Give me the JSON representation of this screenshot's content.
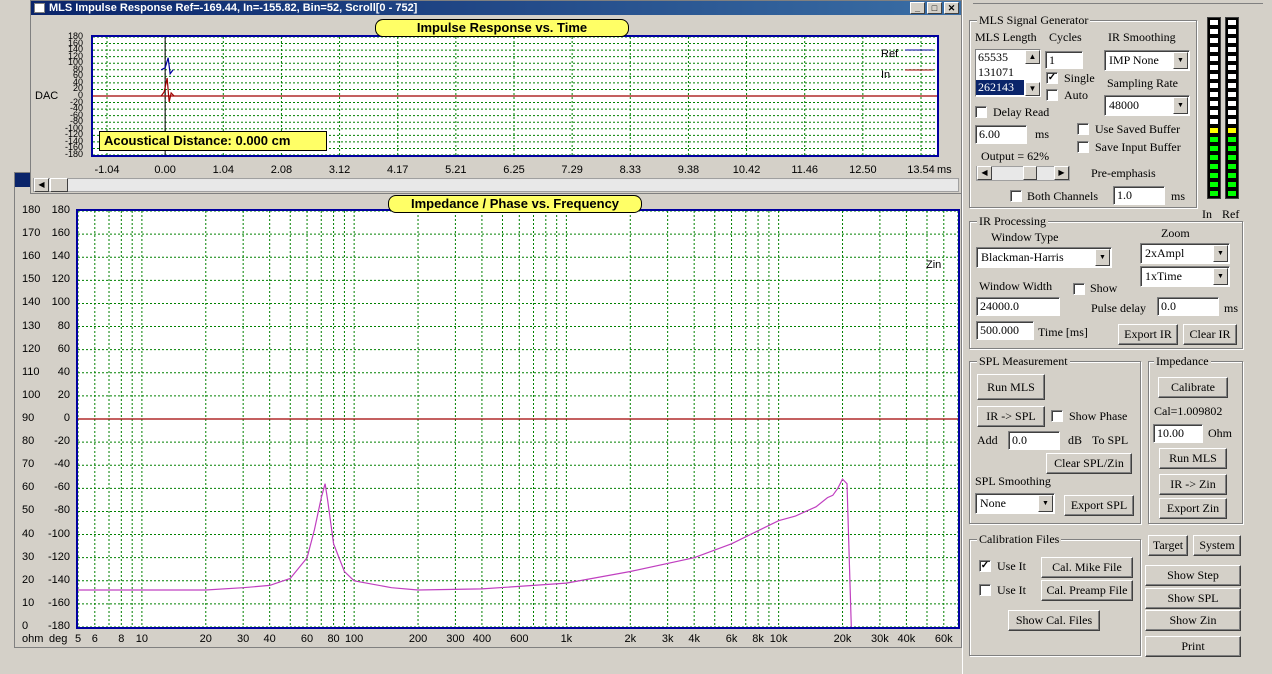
{
  "impulse_window": {
    "title": "MLS Impulse Response  Ref=-169.44, In=-155.82, Bin=52, Scroll[0 - 752]",
    "plot_title": "Impulse Response vs. Time",
    "y_axis_label": "DAC",
    "y_ticks": [
      "180",
      "160",
      "140",
      "120",
      "100",
      "80",
      "60",
      "40",
      "20",
      "0",
      "-20",
      "-40",
      "-60",
      "-80",
      "-100",
      "-120",
      "-140",
      "-160",
      "-180"
    ],
    "x_ticks": [
      "-1.04",
      "0.00",
      "1.04",
      "2.08",
      "3.12",
      "4.17",
      "5.21",
      "6.25",
      "7.29",
      "8.33",
      "9.38",
      "10.42",
      "11.46",
      "12.50",
      "13.54"
    ],
    "x_unit": "ms",
    "legend": [
      "Ref",
      "In"
    ],
    "distance_label": "Acoustical Distance: 0.000 cm",
    "colors": {
      "ref": "#0000a0",
      "in": "#a00000"
    }
  },
  "impedance_plot": {
    "plot_title": "Impedance / Phase vs. Frequency",
    "ohm_ticks": [
      "180",
      "170",
      "160",
      "150",
      "140",
      "130",
      "120",
      "110",
      "100",
      "90",
      "80",
      "70",
      "60",
      "50",
      "40",
      "30",
      "20",
      "10",
      "0"
    ],
    "deg_ticks": [
      "180",
      "160",
      "140",
      "120",
      "100",
      "80",
      "60",
      "40",
      "20",
      "0",
      "-20",
      "-40",
      "-60",
      "-80",
      "-100",
      "-120",
      "-140",
      "-160",
      "-180"
    ],
    "ohm_unit": "ohm",
    "deg_unit": "deg",
    "x_ticks": [
      "5",
      "6",
      "8",
      "10",
      "20",
      "30",
      "40",
      "60",
      "80",
      "100",
      "200",
      "300",
      "400",
      "600",
      "1k",
      "2k",
      "3k",
      "4k",
      "6k",
      "8k",
      "10k",
      "20k",
      "30k",
      "40k",
      "60k"
    ],
    "legend": "Zin",
    "colors": {
      "zin": "#c040c0",
      "phase": "#a00000"
    }
  },
  "chart_data": {
    "type": "line",
    "title": "Impedance / Phase vs. Frequency",
    "xlabel": "",
    "ylabel": "ohm",
    "x_scale": "log",
    "xlim": [
      5,
      70000
    ],
    "ylim": [
      0,
      180
    ],
    "grid": true,
    "series": [
      {
        "name": "Zin",
        "x": [
          5,
          10,
          20,
          30,
          40,
          50,
          60,
          65,
          70,
          73,
          75,
          80,
          90,
          100,
          150,
          200,
          400,
          1000,
          2000,
          4000,
          6000,
          10000,
          12000,
          15000,
          17000,
          18000,
          19000,
          20000,
          21000,
          22000
        ],
        "values": [
          16,
          16,
          16,
          17,
          18,
          21,
          30,
          42,
          56,
          62,
          55,
          36,
          24,
          20,
          17,
          16,
          16.5,
          19,
          24,
          30,
          36,
          46,
          48,
          52,
          56,
          57,
          60,
          64,
          62,
          0
        ]
      },
      {
        "x": [
          5,
          70000
        ],
        "values": [
          90,
          90
        ]
      }
    ]
  },
  "generator": {
    "group_label": "MLS Signal Generator",
    "mls_length_label": "MLS Length",
    "mls_options": [
      "65535",
      "131071",
      "262143"
    ],
    "cycles_label": "Cycles",
    "cycles_value": "1",
    "single_label": "Single",
    "auto_label": "Auto",
    "ir_smoothing_label": "IR Smoothing",
    "ir_smoothing_value": "IMP None",
    "sampling_rate_label": "Sampling Rate",
    "sampling_rate_value": "48000",
    "delay_read_label": "Delay Read",
    "delay_value": "6.00",
    "delay_unit": "ms",
    "use_saved_label": "Use Saved Buffer",
    "save_input_label": "Save Input Buffer",
    "output_label": "Output = 62%",
    "output_level": 0.62,
    "preemph_label": "Pre-emphasis",
    "both_channels_label": "Both Channels",
    "preemph_value": "1.0",
    "preemph_unit": "ms"
  },
  "meters": {
    "in_label": "In",
    "ref_label": "Ref",
    "green": "#00ff00",
    "yellow": "#ffff00",
    "off": "#ffffff"
  },
  "ir_processing": {
    "group_label": "IR Processing",
    "window_type_label": "Window Type",
    "window_type_value": "Blackman-Harris",
    "zoom_label": "Zoom",
    "zoom_ampl_value": "2xAmpl",
    "zoom_time_value": "1xTime",
    "window_width_label": "Window Width",
    "show_label": "Show",
    "window_width_value": "24000.0",
    "pulse_delay_label": "Pulse delay",
    "pulse_delay_value": "0.0",
    "pulse_delay_unit": "ms",
    "time_value": "500.000",
    "time_label": "Time [ms]",
    "export_ir": "Export IR",
    "clear_ir": "Clear IR"
  },
  "spl": {
    "group_label": "SPL Measurement",
    "run_mls": "Run MLS",
    "ir_to_spl": "IR -> SPL",
    "show_phase_label": "Show Phase",
    "add_label": "Add",
    "add_value": "0.0",
    "db_label": "dB",
    "to_spl_label": "To SPL",
    "clear_spl_zin": "Clear SPL/Zin",
    "smoothing_label": "SPL Smoothing",
    "smoothing_value": "None",
    "export_spl": "Export SPL"
  },
  "impedance": {
    "group_label": "Impedance",
    "calibrate": "Calibrate",
    "cal_label": "Cal=1.009802",
    "ohm_value": "10.00",
    "ohm_unit": "Ohm",
    "run_mls": "Run MLS",
    "ir_to_zin": "IR -> Zin",
    "export_zin": "Export Zin"
  },
  "calibration": {
    "group_label": "Calibration Files",
    "use_it_1": "Use It",
    "use_it_2": "Use It",
    "cal_mike": "Cal. Mike File",
    "cal_preamp": "Cal. Preamp File",
    "show_cal_files": "Show Cal. Files"
  },
  "side_buttons": {
    "target": "Target",
    "system": "System",
    "show_step": "Show Step",
    "show_spl": "Show SPL",
    "show_zin": "Show Zin",
    "print": "Print"
  }
}
